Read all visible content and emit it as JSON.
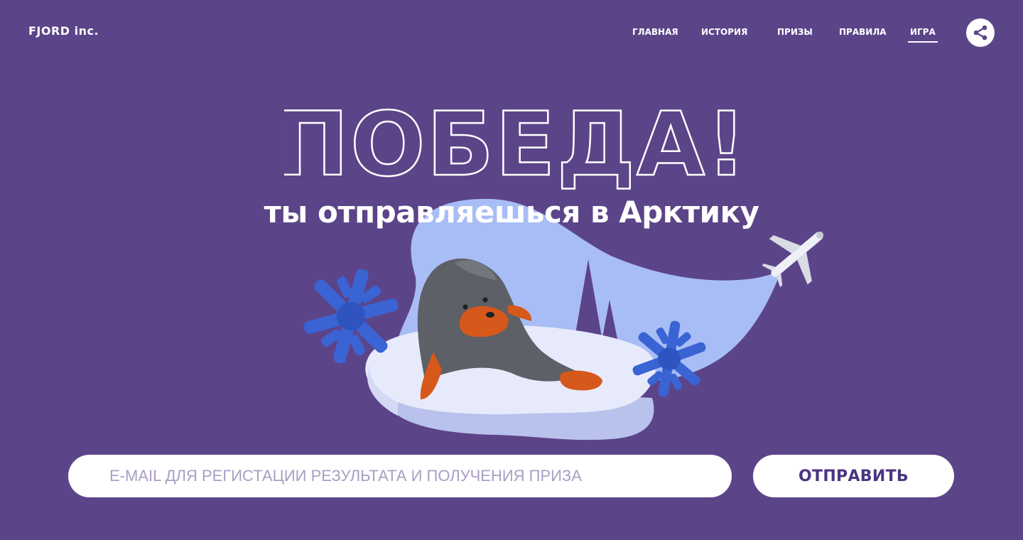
{
  "header": {
    "logo": "FJORD inc.",
    "nav": [
      {
        "label": "ГЛАВНАЯ",
        "active": false
      },
      {
        "label": "ИСТОРИЯ",
        "active": false
      },
      {
        "label": "ПРИЗЫ",
        "active": false
      },
      {
        "label": "ПРАВИЛА",
        "active": false
      },
      {
        "label": "ИГРА",
        "active": true
      }
    ],
    "share_icon": "share-icon"
  },
  "hero": {
    "title": "ПОБЕДА!",
    "subtitle": "ты отправляешься в Арктику"
  },
  "illustration": {
    "icons": [
      "seal-icon",
      "snowflake-icon",
      "airplane-icon",
      "ice-floe-icon"
    ]
  },
  "form": {
    "email_placeholder": "E-MAIL ДЛЯ РЕГИСТАЦИИ РЕЗУЛЬТАТА И ПОЛУЧЕНИЯ ПРИЗА",
    "email_value": "",
    "submit_label": "ОТПРАВИТЬ"
  },
  "colors": {
    "background": "#5c4489",
    "accent_light_blue": "#a8bdf6",
    "snowflake_blue": "#3a63d4",
    "seal_grey": "#5d6066",
    "seal_orange": "#d6581b",
    "button_text": "#4b3483"
  }
}
